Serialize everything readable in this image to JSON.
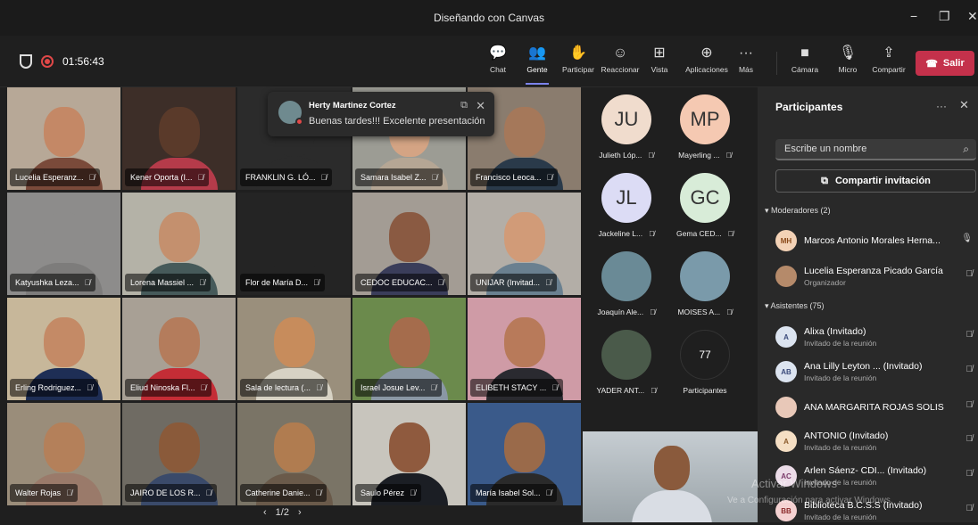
{
  "window": {
    "title": "Diseñando con Canvas",
    "min": "−",
    "max": "❐",
    "close": "✕"
  },
  "meeting": {
    "timer": "01:56:43"
  },
  "toolbar": {
    "items": [
      {
        "label": "Chat",
        "icon": "💬"
      },
      {
        "label": "Gente",
        "icon": "👥"
      },
      {
        "label": "Participar",
        "icon": "✋"
      },
      {
        "label": "Reaccionar",
        "icon": "☺"
      },
      {
        "label": "Vista",
        "icon": "⊞"
      },
      {
        "label": "Aplicaciones",
        "icon": "⊕"
      },
      {
        "label": "Más",
        "icon": "···"
      },
      {
        "label": "Cámara",
        "icon": "■"
      },
      {
        "label": "Micro",
        "icon": "🎙"
      },
      {
        "label": "Compartir",
        "icon": "⇪"
      }
    ],
    "leave": "Salir"
  },
  "tiles": [
    {
      "name": "Lucelia Esperanz...",
      "bg": "#b7a897",
      "skin": "#c48866",
      "shirt": "#7a4a3a"
    },
    {
      "name": "Kener Oporta (I...",
      "bg": "#3d2e28",
      "skin": "#5a3a2a",
      "shirt": "#b53b4a"
    },
    {
      "name": "FRANKLIN G. LÓ...",
      "bg": "#2b2b2b",
      "skin": "#2b2b2b",
      "shirt": "#2b2b2b"
    },
    {
      "name": "Samara Isabel Z...",
      "bg": "#9c9c94",
      "skin": "#d4a484",
      "shirt": "#b5a694"
    },
    {
      "name": "Francisco Leoca...",
      "bg": "#8a7c6e",
      "skin": "#a5785a",
      "shirt": "#2a3a4a"
    },
    {
      "name": "Katyushka Leza...",
      "bg": "#8d8c8b",
      "skin": "#8d8c8b",
      "shirt": "#7d7c7b"
    },
    {
      "name": "Lorena Massiel ...",
      "bg": "#b4b2a7",
      "skin": "#c4906e",
      "shirt": "#465a5a"
    },
    {
      "name": "Flor de María D...",
      "bg": "#242424",
      "skin": "#242424",
      "shirt": "#242424"
    },
    {
      "name": "CEDOC EDUCAC...",
      "bg": "#a39c94",
      "skin": "#8a5a42",
      "shirt": "#3a3d5a"
    },
    {
      "name": "UNIJAR (Invitad...",
      "bg": "#b3aea7",
      "skin": "#d19b78",
      "shirt": "#6a8090"
    },
    {
      "name": "Erling Rodriguez...",
      "bg": "#c7b79a",
      "skin": "#c48a66",
      "shirt": "#1e2e55"
    },
    {
      "name": "Eliud Ninoska Fl...",
      "bg": "#a8a095",
      "skin": "#b47c5c",
      "shirt": "#c42d36"
    },
    {
      "name": "Sala de lectura (...",
      "bg": "#9a8f7c",
      "skin": "#c78c5c",
      "shirt": "#d7d2c4"
    },
    {
      "name": "Israel Josue Lev...",
      "bg": "#6b8a4c",
      "skin": "#a56c4c",
      "shirt": "#8a97a4"
    },
    {
      "name": "ELIBETH STACY ...",
      "bg": "#cf9ba6",
      "skin": "#b87a5a",
      "shirt": "#2a2a30"
    },
    {
      "name": "Walter Rojas",
      "bg": "#9a8d7a",
      "skin": "#b4805a",
      "shirt": "#9a7a6a"
    },
    {
      "name": "JAIRO DE LOS R...",
      "bg": "#6f6b63",
      "skin": "#8a5a3a",
      "shirt": "#3a4a6a"
    },
    {
      "name": "Catherine Danie...",
      "bg": "#7a7466",
      "skin": "#b07c50",
      "shirt": "#6a5a4a"
    },
    {
      "name": "Saulo Pérez",
      "bg": "#c8c5bd",
      "skin": "#8f5a3e",
      "shirt": "#1b1e24"
    },
    {
      "name": "María Isabel Sol...",
      "bg": "#3a5a8a",
      "skin": "#9a6a4a",
      "shirt": "#2a2a2a"
    }
  ],
  "notification": {
    "sender": "Herty Martinez Cortez",
    "message": "Buenas tardes!!! Excelente presentación"
  },
  "pager": {
    "prev": "‹",
    "page": "1/2",
    "next": "›"
  },
  "side_participants": [
    {
      "initials": "JU",
      "name": "Julieth Lóp...",
      "color": "#f0dccd"
    },
    {
      "initials": "MP",
      "name": "Mayerling ...",
      "color": "#f5c9b2"
    },
    {
      "initials": "JL",
      "name": "Jackeline L...",
      "color": "#dcdcf5"
    },
    {
      "initials": "GC",
      "name": "Gema CED...",
      "color": "#d8ecd8"
    },
    {
      "initials": "",
      "name": "Joaquín Ale...",
      "color": "#6a8a96"
    },
    {
      "initials": "",
      "name": "MOISES A...",
      "color": "#7a9aaa"
    },
    {
      "initials": "",
      "name": "YADER ANT...",
      "color": "#4a5a4a"
    },
    {
      "initials": "77",
      "name": "Participantes",
      "color": "#1f1f1f"
    }
  ],
  "panel": {
    "title": "Participantes",
    "more": "···",
    "close": "✕",
    "search_placeholder": "Escribe un nombre",
    "share": "Compartir invitación",
    "moderators_label": "Moderadores (2)",
    "attendees_label": "Asistentes (75)",
    "moderators": [
      {
        "initials": "MH",
        "name": "Marcos Antonio Morales Herna...",
        "sub": "",
        "color": "#f3d2b6",
        "tc": "#8a4a1a"
      },
      {
        "initials": "",
        "name": "Lucelia Esperanza Picado García",
        "sub": "Organizador",
        "color": "#b58a6a",
        "tc": "#fff"
      }
    ],
    "attendees": [
      {
        "initials": "A",
        "name": "Alixa (Invitado)",
        "sub": "Invitado de la reunión",
        "color": "#dce4f0",
        "tc": "#3a4a7a"
      },
      {
        "initials": "AB",
        "name": "Ana Lilly Leyton ... (Invitado)",
        "sub": "Invitado de la reunión",
        "color": "#dce4f0",
        "tc": "#3a4a7a"
      },
      {
        "initials": "",
        "name": "ANA MARGARITA ROJAS SOLIS",
        "sub": "",
        "color": "#e8c8b8",
        "tc": "#333"
      },
      {
        "initials": "A",
        "name": "ANTONIO (Invitado)",
        "sub": "Invitado de la reunión",
        "color": "#f5dfc4",
        "tc": "#8a5a2a"
      },
      {
        "initials": "AC",
        "name": "Arlen Sáenz- CDI... (Invitado)",
        "sub": "Invitado de la reunión",
        "color": "#ecdce8",
        "tc": "#7a3a6a"
      },
      {
        "initials": "BB",
        "name": "Biblioteca B.C.S.S (Invitado)",
        "sub": "Invitado de la reunión",
        "color": "#f5d2d2",
        "tc": "#8a2a2a"
      }
    ]
  },
  "watermark": {
    "line1": "Activar Windows",
    "line2": "Ve a Configuración para activar Windows."
  }
}
